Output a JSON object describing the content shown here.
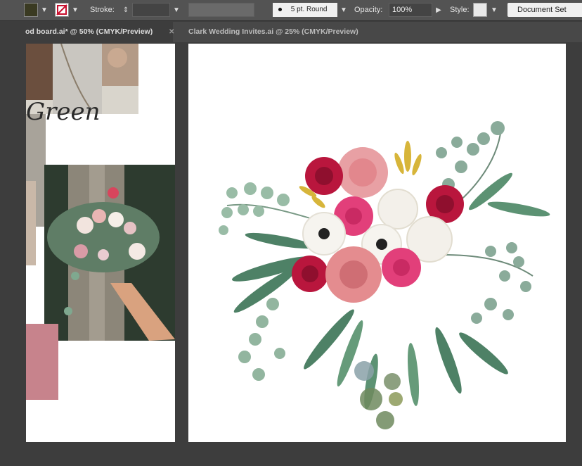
{
  "control_bar": {
    "stroke_label": "Stroke:",
    "brush_label": "5 pt. Round",
    "opacity_label": "Opacity:",
    "opacity_value": "100%",
    "style_label": "Style:",
    "document_setup_label": "Document Set"
  },
  "tabs": [
    {
      "label": "od board.ai* @ 50% (CMYK/Preview)",
      "active": true
    },
    {
      "label": "Clark Wedding Invites.ai @ 25% (CMYK/Preview)",
      "active": false
    }
  ],
  "left_artboard": {
    "script_text": "Green",
    "colors": {
      "mauve_block": "#c7838c",
      "gray_block": "#a8a39a",
      "photo_bg": "#2d3b2f"
    }
  },
  "right_artboard": {
    "colors": {
      "rose_red": "#b9163d",
      "rose_pink": "#e8a0a4",
      "peony_pink": "#e23f7a",
      "ranunculus_white": "#f3f0ea",
      "eucalyptus": "#7fa88f",
      "leaf_dark": "#2f6b4b",
      "goldenrod": "#d7b53a"
    }
  }
}
